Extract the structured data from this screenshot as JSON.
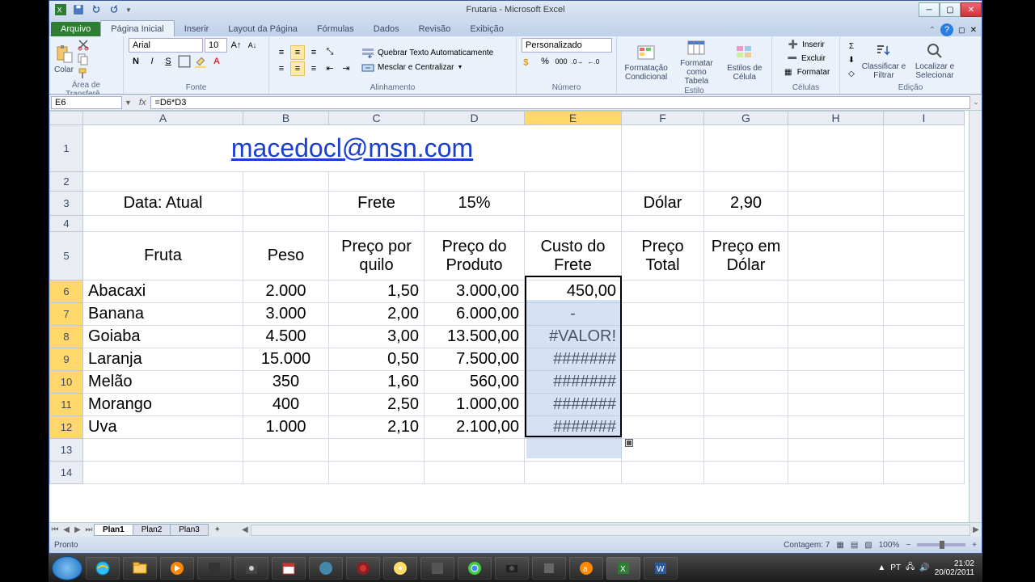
{
  "window": {
    "title": "Frutaria - Microsoft Excel"
  },
  "ribbon": {
    "file": "Arquivo",
    "tabs": [
      "Página Inicial",
      "Inserir",
      "Layout da Página",
      "Fórmulas",
      "Dados",
      "Revisão",
      "Exibição"
    ],
    "clipboard": {
      "paste": "Colar",
      "group": "Área de Transferê..."
    },
    "font": {
      "name": "Arial",
      "size": "10",
      "group": "Fonte"
    },
    "alignment": {
      "wrap": "Quebrar Texto Automaticamente",
      "merge": "Mesclar e Centralizar",
      "group": "Alinhamento"
    },
    "number": {
      "format": "Personalizado",
      "group": "Número"
    },
    "styles": {
      "cond": "Formatação Condicional",
      "table": "Formatar como Tabela",
      "cell": "Estilos de Célula",
      "group": "Estilo"
    },
    "cells": {
      "insert": "Inserir",
      "delete": "Excluir",
      "format": "Formatar",
      "group": "Células"
    },
    "editing": {
      "sort": "Classificar e Filtrar",
      "find": "Localizar e Selecionar",
      "group": "Edição"
    }
  },
  "formula": {
    "namebox": "E6",
    "value": "=D6*D3"
  },
  "columns": [
    "A",
    "B",
    "C",
    "D",
    "E",
    "F",
    "G",
    "H",
    "I"
  ],
  "rowH": {
    "r1": 58,
    "r3": 30,
    "r5": 60,
    "def": 28
  },
  "cells": {
    "email": "macedocl@msn.com",
    "A3": "Data: Atual",
    "C3": "Frete",
    "D3": "15%",
    "F3": "Dólar",
    "G3": "2,90",
    "A5": "Fruta",
    "B5": "Peso",
    "C5": "Preço por quilo",
    "D5": "Preço do Produto",
    "E5": "Custo do Frete",
    "F5": "Preço Total",
    "G5": "Preço em Dólar"
  },
  "data_rows": [
    {
      "A": "Abacaxi",
      "B": "2.000",
      "C": "1,50",
      "D": "3.000,00",
      "E": "450,00"
    },
    {
      "A": "Banana",
      "B": "3.000",
      "C": "2,00",
      "D": "6.000,00",
      "E": "-"
    },
    {
      "A": "Goiaba",
      "B": "4.500",
      "C": "3,00",
      "D": "13.500,00",
      "E": "#VALOR!"
    },
    {
      "A": "Laranja",
      "B": "15.000",
      "C": "0,50",
      "D": "7.500,00",
      "E": "#######"
    },
    {
      "A": "Melão",
      "B": "350",
      "C": "1,60",
      "D": "560,00",
      "E": "#######"
    },
    {
      "A": "Morango",
      "B": "400",
      "C": "2,50",
      "D": "1.000,00",
      "E": "#######"
    },
    {
      "A": "Uva",
      "B": "1.000",
      "C": "2,10",
      "D": "2.100,00",
      "E": "#######"
    }
  ],
  "sheets": [
    "Plan1",
    "Plan2",
    "Plan3"
  ],
  "status": {
    "ready": "Pronto",
    "count": "Contagem: 7",
    "zoom": "100%"
  },
  "tray": {
    "lang": "PT",
    "time": "21:02",
    "date": "20/02/2011"
  }
}
